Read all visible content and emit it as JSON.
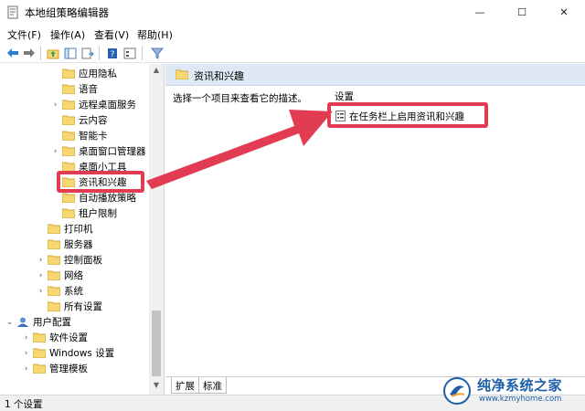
{
  "window": {
    "title": "本地组策略编辑器",
    "minimize": "—",
    "maximize": "☐",
    "close": "✕"
  },
  "menu": [
    "文件(F)",
    "操作(A)",
    "查看(V)",
    "帮助(H)"
  ],
  "tree": [
    {
      "label": "应用隐私",
      "level": 3,
      "chevron": ""
    },
    {
      "label": "语音",
      "level": 3,
      "chevron": ""
    },
    {
      "label": "远程桌面服务",
      "level": 3,
      "chevron": ">"
    },
    {
      "label": "云内容",
      "level": 3,
      "chevron": ""
    },
    {
      "label": "智能卡",
      "level": 3,
      "chevron": ""
    },
    {
      "label": "桌面窗口管理器",
      "level": 3,
      "chevron": ">"
    },
    {
      "label": "桌面小工具",
      "level": 3,
      "chevron": ""
    },
    {
      "label": "资讯和兴趣",
      "level": 3,
      "chevron": ""
    },
    {
      "label": "自动播放策略",
      "level": 3,
      "chevron": ""
    },
    {
      "label": "租户限制",
      "level": 3,
      "chevron": ""
    },
    {
      "label": "打印机",
      "level": 2,
      "chevron": ""
    },
    {
      "label": "服务器",
      "level": 2,
      "chevron": ""
    },
    {
      "label": "控制面板",
      "level": 2,
      "chevron": ">"
    },
    {
      "label": "网络",
      "level": 2,
      "chevron": ">"
    },
    {
      "label": "系统",
      "level": 2,
      "chevron": ">"
    },
    {
      "label": "所有设置",
      "level": 2,
      "chevron": ""
    },
    {
      "label": "用户配置",
      "level": 0,
      "chevron": "v"
    },
    {
      "label": "软件设置",
      "level": 1,
      "chevron": ">"
    },
    {
      "label": "Windows 设置",
      "level": 1,
      "chevron": ">"
    },
    {
      "label": "管理模板",
      "level": 1,
      "chevron": ">"
    }
  ],
  "right": {
    "header_title": "资讯和兴趣",
    "description": "选择一个项目来查看它的描述。",
    "column_setting": "设置",
    "items": [
      "在任务栏上启用资讯和兴趣"
    ]
  },
  "tabs": [
    "扩展",
    "标准"
  ],
  "status": "1 个设置",
  "watermark": {
    "title": "纯净系统之家",
    "url": "www.kzmyhome.com"
  },
  "colors": {
    "highlight": "#e23c52",
    "folder": "#f7d674",
    "header_bg": "#dfe9f5"
  }
}
